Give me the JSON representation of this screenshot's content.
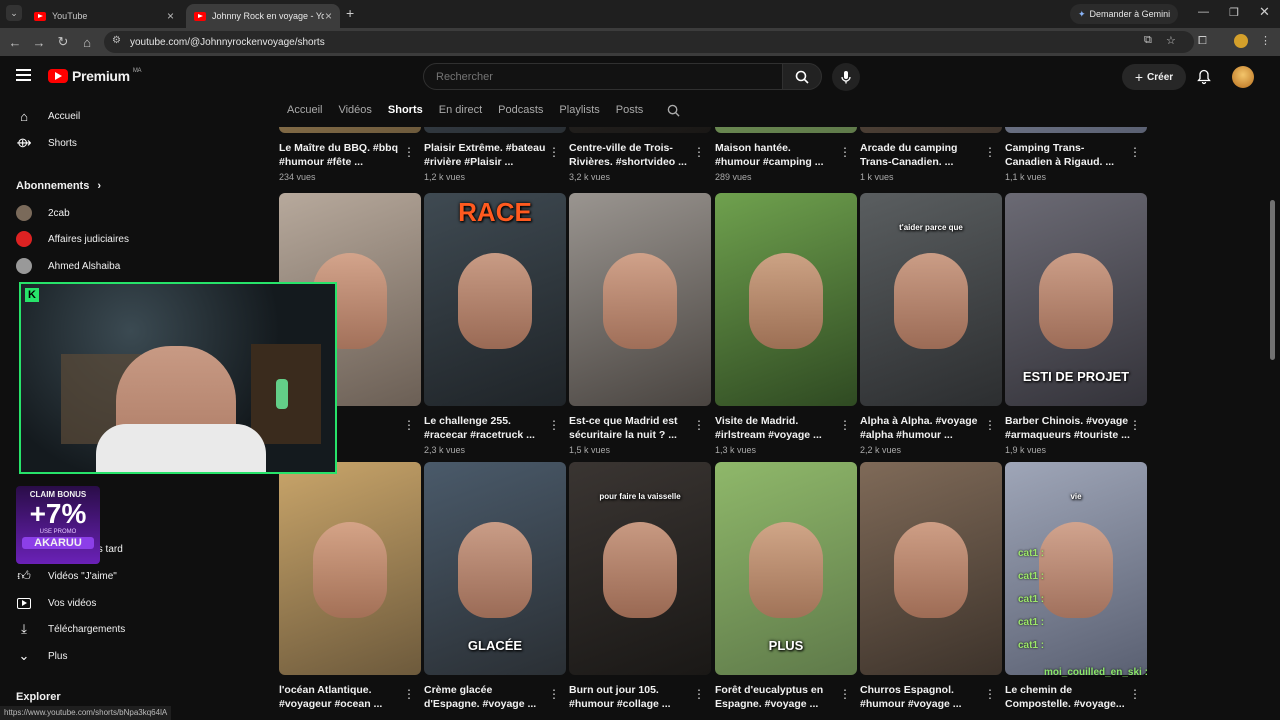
{
  "browser": {
    "tabs": [
      {
        "title": "YouTube",
        "active": false
      },
      {
        "title": "Johnny Rock en voyage - YouTu",
        "active": true
      }
    ],
    "gemini_label": "Demander à Gemini",
    "url": "youtube.com/@Johnnyrockenvoyage/shorts",
    "status_url": "https://www.youtube.com/shorts/bNpa3kq64lA"
  },
  "header": {
    "logo_text": "Premium",
    "logo_region": "MA",
    "search_placeholder": "Rechercher",
    "create_label": "Créer"
  },
  "channel_tabs": [
    {
      "label": "Accueil",
      "selected": false
    },
    {
      "label": "Vidéos",
      "selected": false
    },
    {
      "label": "Shorts",
      "selected": true
    },
    {
      "label": "En direct",
      "selected": false
    },
    {
      "label": "Podcasts",
      "selected": false
    },
    {
      "label": "Playlists",
      "selected": false
    },
    {
      "label": "Posts",
      "selected": false
    }
  ],
  "sidebar": {
    "home": "Accueil",
    "shorts": "Shorts",
    "subscriptions_title": "Abonnements",
    "subs": [
      {
        "name": "2cab"
      },
      {
        "name": "Affaires judiciaires"
      },
      {
        "name": "Ahmed Alshaiba"
      }
    ],
    "later_partial": "lus tard",
    "liked": "Vidéos \"J'aime\"",
    "your_videos": "Vos vidéos",
    "downloads": "Téléchargements",
    "more": "Plus",
    "explore": "Explorer"
  },
  "rows": [
    [
      {
        "title1": "Le Maître du BBQ.  #bbq",
        "title2": "#humour #fête ...",
        "views": "234 vues"
      },
      {
        "title1": "Plaisir Extrême. #bateau",
        "title2": "#rivière #Plaisir ...",
        "views": "1,2 k vues"
      },
      {
        "title1": "Centre-ville de Trois-",
        "title2": "Rivières. #shortvideo ...",
        "views": "3,2 k vues"
      },
      {
        "title1": "Maison hantée.",
        "title2": "#humour #camping ...",
        "views": "289 vues"
      },
      {
        "title1": "Arcade du camping",
        "title2": "Trans-Canadien.  ...",
        "views": "1 k vues"
      },
      {
        "title1": "Camping Trans-",
        "title2": "Canadien à Rigaud.  ...",
        "views": "1,1 k vues"
      }
    ],
    [
      {
        "title1": "inois au",
        "title2": "umour ...",
        "views": "",
        "overlay": ""
      },
      {
        "title1": "Le challenge 255.",
        "title2": "#racecar #racetruck ...",
        "views": "2,3 k vues",
        "overlay": "RACE"
      },
      {
        "title1": "Est-ce que Madrid est",
        "title2": "sécuritaire la nuit ? ...",
        "views": "1,5 k vues",
        "overlay": ""
      },
      {
        "title1": "Visite de Madrid.",
        "title2": "#irlstream #voyage ...",
        "views": "1,3 k vues",
        "overlay": ""
      },
      {
        "title1": "Alpha à Alpha. #voyage",
        "title2": "#alpha #humour ...",
        "views": "2,2 k vues",
        "overlay": "t'aider parce que"
      },
      {
        "title1": "Barber Chinois. #voyage",
        "title2": "#armaqueurs #touriste ...",
        "views": "1,9 k vues",
        "overlay": "ESTI DE PROJET"
      }
    ],
    [
      {
        "title1": "l'océan Atlantique.",
        "title2": "#voyageur #ocean ...",
        "overlay": ""
      },
      {
        "title1": "Crème glacée",
        "title2": "d'Espagne. #voyage ...",
        "overlay": "GLACÉE"
      },
      {
        "title1": "Burn out jour 105.",
        "title2": "#humour #collage ...",
        "overlay": "pour faire la vaisselle"
      },
      {
        "title1": "Forêt d'eucalyptus en",
        "title2": "Espagne.  #voyage ...",
        "overlay": "PLUS"
      },
      {
        "title1": "Churros Espagnol.",
        "title2": "#humour #voyage ...",
        "overlay": ""
      },
      {
        "title1": "Le chemin de",
        "title2": "Compostelle.  #voyage...",
        "overlay": "vie"
      }
    ]
  ],
  "overlay_promo": {
    "line1": "CLAIM BONUS",
    "line2": "+7%",
    "line3": "USE PROMO",
    "line4": "AKARUU"
  },
  "chat": {
    "lines": [
      "cat1 :",
      "cat1 :",
      "cat1 :",
      "cat1 :",
      "cat1 :"
    ],
    "bottom_user": "moi_couilled_en_ski :"
  },
  "colors": {
    "accent": "#ff0000",
    "webcam_border": "#27e36a",
    "promo": "#6a21b7"
  }
}
